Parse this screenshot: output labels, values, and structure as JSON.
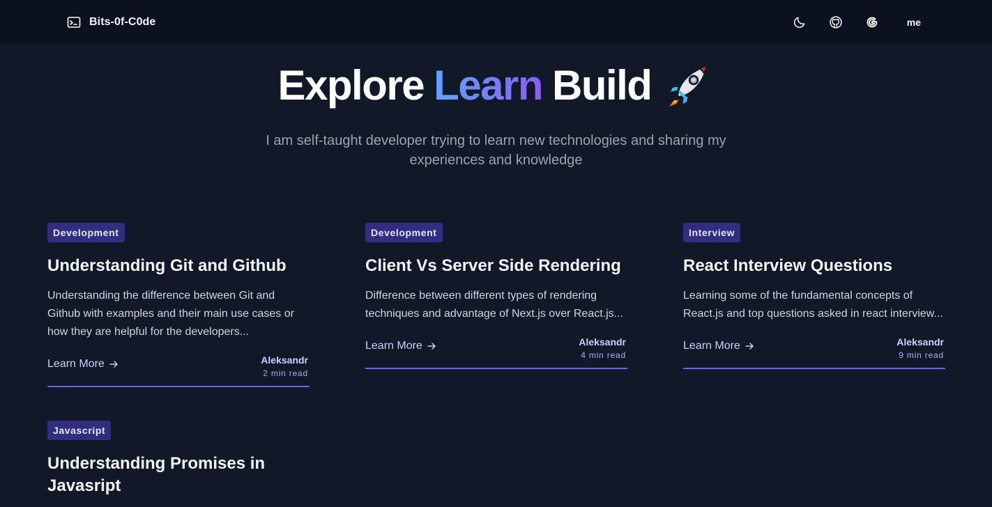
{
  "nav": {
    "brand": "Bits-0f-C0de",
    "brand_icon": "terminal-icon",
    "theme_icon": "moon-icon",
    "github_icon": "github-icon",
    "google_icon": "google-icon",
    "me_label": "me"
  },
  "hero": {
    "word1": "Explore",
    "word2": "Learn",
    "word3": "Build",
    "emoji_icon": "rocket-icon",
    "subtitle": "I am self-taught developer trying to learn new technologies and sharing my experiences and knowledge"
  },
  "posts": [
    {
      "tag": "Development",
      "title": "Understanding Git and Github",
      "description": "Understanding the difference between Git and Github with examples and their main use cases or how they are helpful for the developers...",
      "link": "Learn More",
      "author": "Aleksandr",
      "read_time": "2 min read"
    },
    {
      "tag": "Development",
      "title": "Client Vs Server Side Rendering",
      "description": "Difference between different types of rendering techniques and advantage of Next.js over React.js...",
      "link": "Learn More",
      "author": "Aleksandr",
      "read_time": "4 min read"
    },
    {
      "tag": "Interview",
      "title": "React Interview Questions",
      "description": "Learning some of the fundamental concepts of React.js and top questions asked in react interview...",
      "link": "Learn More",
      "author": "Aleksandr",
      "read_time": "9 min read"
    },
    {
      "tag": "Javascript",
      "title": "Understanding Promises in Javasript"
    }
  ],
  "colors": {
    "background": "#111827",
    "navbar": "#0b111e",
    "tag_bg": "#312e81",
    "accent": "#6366f1",
    "gradient_start": "#60a5fa",
    "gradient_end": "#8b5cf6"
  }
}
